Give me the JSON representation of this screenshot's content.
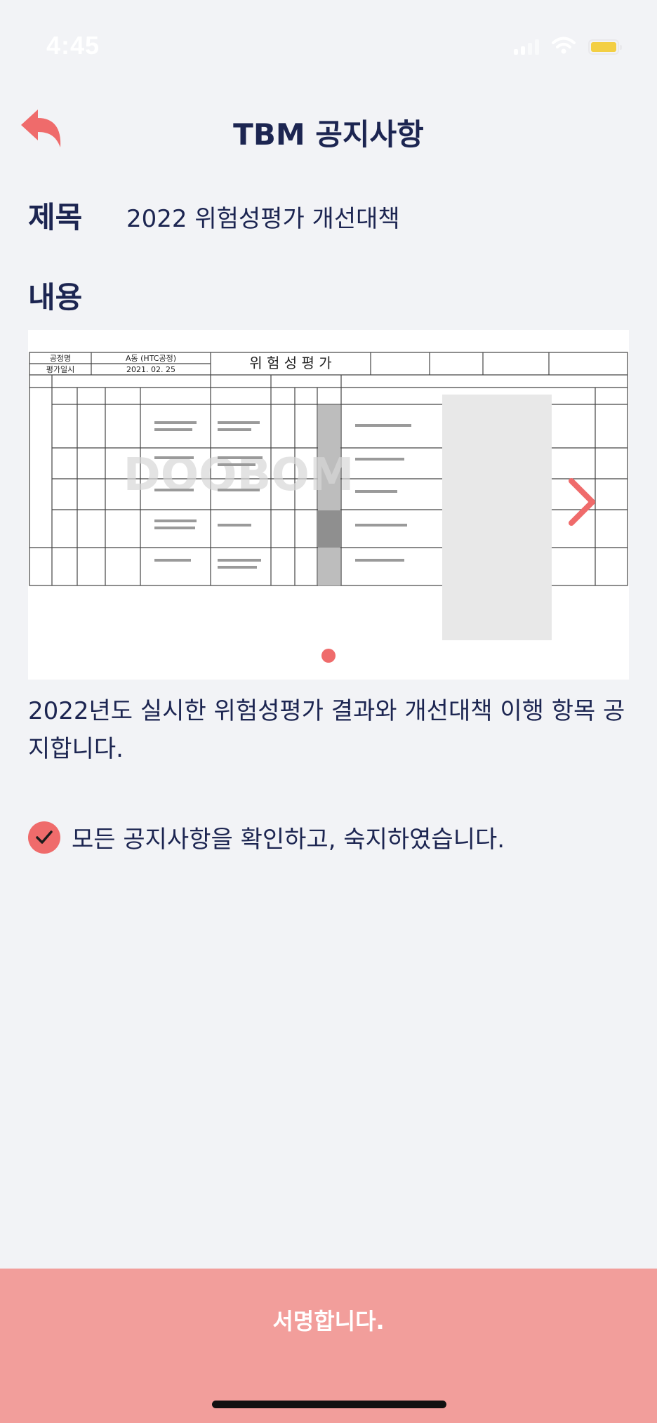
{
  "status_bar": {
    "time": "4:45"
  },
  "header": {
    "title": "TBM 공지사항"
  },
  "notice": {
    "title_label": "제목",
    "title_value": "2022 위험성평가 개선대책",
    "content_label": "내용",
    "content_text": "2022년도 실시한 위험성평가 결과와 개선대책 이행 항목 공지합니다."
  },
  "document": {
    "main_title": "위 험 성 평 가",
    "process_label": "공정명",
    "process_value": "A동 (HTC공정)",
    "date_label": "평가일시",
    "date_value": "2021. 02. 25",
    "watermark": "DOOBOM"
  },
  "carousel": {
    "current_page": 1
  },
  "confirm": {
    "checked": true,
    "label": "모든 공지사항을 확인하고, 숙지하였습니다."
  },
  "sign_button": {
    "label": "서명합니다."
  },
  "colors": {
    "accent": "#ef6b6b",
    "navy": "#1c2551",
    "button_bg": "#f29e9b",
    "background": "#f2f3f6"
  },
  "icons": {
    "back": "back-arrow-icon",
    "next": "chevron-right-icon",
    "check": "checkmark-icon"
  }
}
